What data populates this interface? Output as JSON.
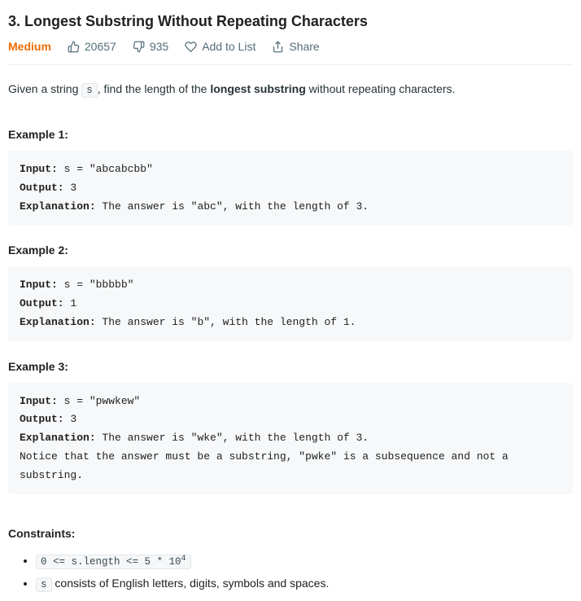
{
  "title": "3. Longest Substring Without Repeating Characters",
  "meta": {
    "difficulty": "Medium",
    "likes": "20657",
    "dislikes": "935",
    "add_to_list": "Add to List",
    "share": "Share"
  },
  "description": {
    "prefix": "Given a string ",
    "code1": "s",
    "mid": ", find the length of the ",
    "bold": "longest substring",
    "suffix": " without repeating characters."
  },
  "examples": [
    {
      "heading": "Example 1:",
      "input_label": "Input:",
      "input_value": " s = \"abcabcbb\"",
      "output_label": "Output:",
      "output_value": " 3",
      "explanation_label": "Explanation:",
      "explanation_value": " The answer is \"abc\", with the length of 3."
    },
    {
      "heading": "Example 2:",
      "input_label": "Input:",
      "input_value": " s = \"bbbbb\"",
      "output_label": "Output:",
      "output_value": " 1",
      "explanation_label": "Explanation:",
      "explanation_value": " The answer is \"b\", with the length of 1."
    },
    {
      "heading": "Example 3:",
      "input_label": "Input:",
      "input_value": " s = \"pwwkew\"",
      "output_label": "Output:",
      "output_value": " 3",
      "explanation_label": "Explanation:",
      "explanation_value": " The answer is \"wke\", with the length of 3.\nNotice that the answer must be a substring, \"pwke\" is a subsequence and not a substring."
    }
  ],
  "constraints": {
    "heading": "Constraints:",
    "items": [
      {
        "code": "0 <= s.length <= 5 * 10",
        "sup": "4",
        "tail": ""
      },
      {
        "code": "s",
        "sup": "",
        "tail": " consists of English letters, digits, symbols and spaces."
      }
    ]
  }
}
